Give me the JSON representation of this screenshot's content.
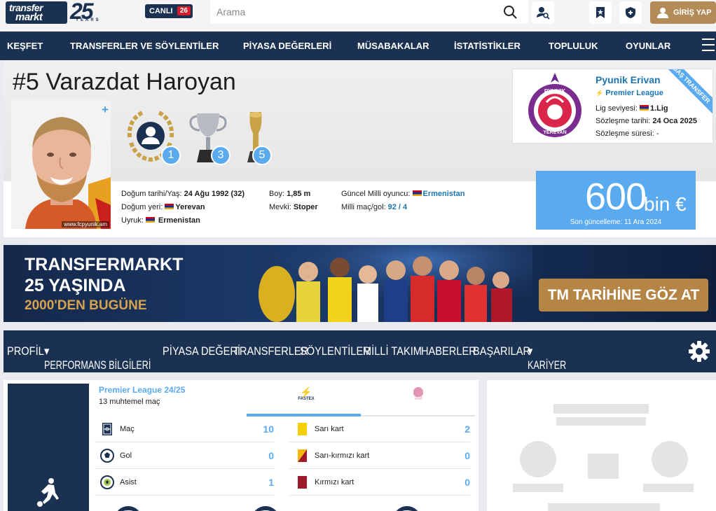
{
  "header": {
    "logo_line1": "transfer",
    "logo_line2": "markt",
    "logo_years": "25",
    "logo_years_word": "YEARS",
    "live_label": "CANLI",
    "live_count": "26",
    "search_placeholder": "Arama",
    "login_label": "GİRİŞ YAP"
  },
  "nav": [
    "KEŞFET",
    "TRANSFERLER VE SÖYLENTİLER",
    "PİYASA DEĞERLERİ",
    "MÜSABAKALAR",
    "İSTATİSTİKLER",
    "TOPLULUK",
    "OYUNLAR"
  ],
  "player": {
    "number": "#5",
    "first_name": "Varazdat",
    "last_name": "Haroyan",
    "photo_credit": "www.fcpyunik.am",
    "trophies": [
      {
        "icon": "player-award-icon",
        "count": "1"
      },
      {
        "icon": "silver-cup-icon",
        "count": "3"
      },
      {
        "icon": "gold-trophy-icon",
        "count": "5"
      }
    ],
    "dob_label": "Doğum tarihi/Yaş:",
    "dob_value": "24 Ağu 1992 (32)",
    "birthplace_label": "Doğum yeri:",
    "birthplace_value": "Yerevan",
    "citizenship_label": "Uyruk:",
    "citizenship_value": "Ermenistan",
    "height_label": "Boy:",
    "height_value": "1,85 m",
    "position_label": "Mevki:",
    "position_value": "Stoper",
    "national_label": "Güncel Milli oyuncu:",
    "national_value": "Ermenistan",
    "caps_label": "Milli maç/gol:",
    "caps_value": "92 / 4"
  },
  "club": {
    "name": "Pyunik Erivan",
    "league": "Premier League",
    "level_label": "Lig seviyesi:",
    "level_value": "1.Lig",
    "contract_label": "Sözleşme tarihi:",
    "contract_value": "24 Oca 2025",
    "duration_label": "Sözleşme süresi:",
    "duration_value": "-",
    "ribbon": "BAŞ TRANSFER",
    "logo_top": "PYUNIK",
    "logo_bottom": "YEREVAN"
  },
  "market_value": {
    "amount": "600",
    "unit": "bin €",
    "updated": "Son güncelleme: 11 Ara 2024"
  },
  "banner": {
    "line1": "TRANSFERMARKT",
    "line2": "25 YAŞINDA",
    "line3": "2000'DEN BUGÜNE",
    "cta": "TM TARİHİNE GÖZ AT"
  },
  "profile_nav": [
    "PROFİL",
    "PERFORMANS BİLGİLERİ",
    "PİYASA DEĞERİ",
    "TRANSFERLER",
    "SÖYLENTİLER",
    "MİLLİ TAKIM",
    "HABERLER",
    "BAŞARILAR",
    "KARİYER"
  ],
  "stats": {
    "competition": "Premier League 24/25",
    "subtitle": "13 muhtemel maç",
    "sponsor1": "FASTEX",
    "sponsor2": "vbet",
    "left": [
      {
        "label": "Maç",
        "value": "10",
        "icon": "pitch-icon"
      },
      {
        "label": "Gol",
        "value": "0",
        "icon": "ball-icon"
      },
      {
        "label": "Asist",
        "value": "1",
        "icon": "assist-ball-icon"
      }
    ],
    "right": [
      {
        "label": "Sarı kart",
        "value": "2",
        "icon": "yellow-card-icon"
      },
      {
        "label": "Sarı-kırmızı kart",
        "value": "0",
        "icon": "yellow-red-card-icon"
      },
      {
        "label": "Kırmızı kart",
        "value": "0",
        "icon": "red-card-icon"
      }
    ]
  },
  "colors": {
    "navy": "#1a3151",
    "accent_blue": "#5aaaf0",
    "gold": "#b28b57",
    "live_red": "#d31e2d"
  }
}
